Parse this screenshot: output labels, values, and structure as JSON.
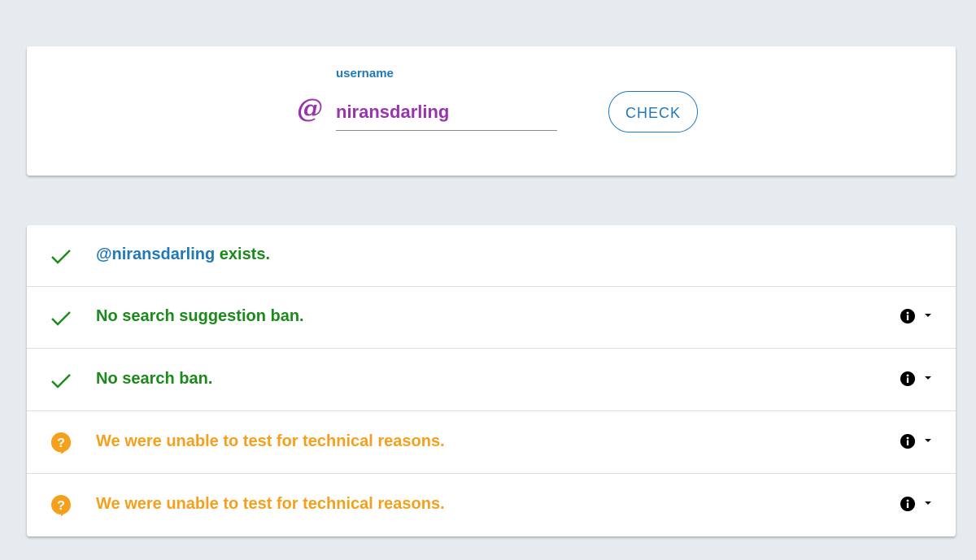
{
  "search": {
    "label": "username",
    "at_symbol": "@",
    "value": "niransdarling",
    "button_label": "CHECK"
  },
  "results": [
    {
      "status": "ok",
      "handle": "@niransdarling",
      "text": " exists.",
      "has_info": false
    },
    {
      "status": "ok",
      "text": "No search suggestion ban.",
      "has_info": true
    },
    {
      "status": "ok",
      "text": "No search ban.",
      "has_info": true
    },
    {
      "status": "unknown",
      "text": "We were unable to test for technical reasons.",
      "has_info": true
    },
    {
      "status": "unknown",
      "text": "We were unable to test for technical reasons.",
      "has_info": true
    }
  ],
  "colors": {
    "background": "#e6ebef",
    "accent_blue": "#1f79b9",
    "username_purple": "#9a33b0",
    "success_green": "#1a8a1a",
    "warning_orange": "#f5a01d"
  },
  "icons": {
    "ok": "checkmark-icon",
    "unknown": "question-bubble-icon",
    "info": "info-icon",
    "toggle": "caret-down-icon"
  }
}
